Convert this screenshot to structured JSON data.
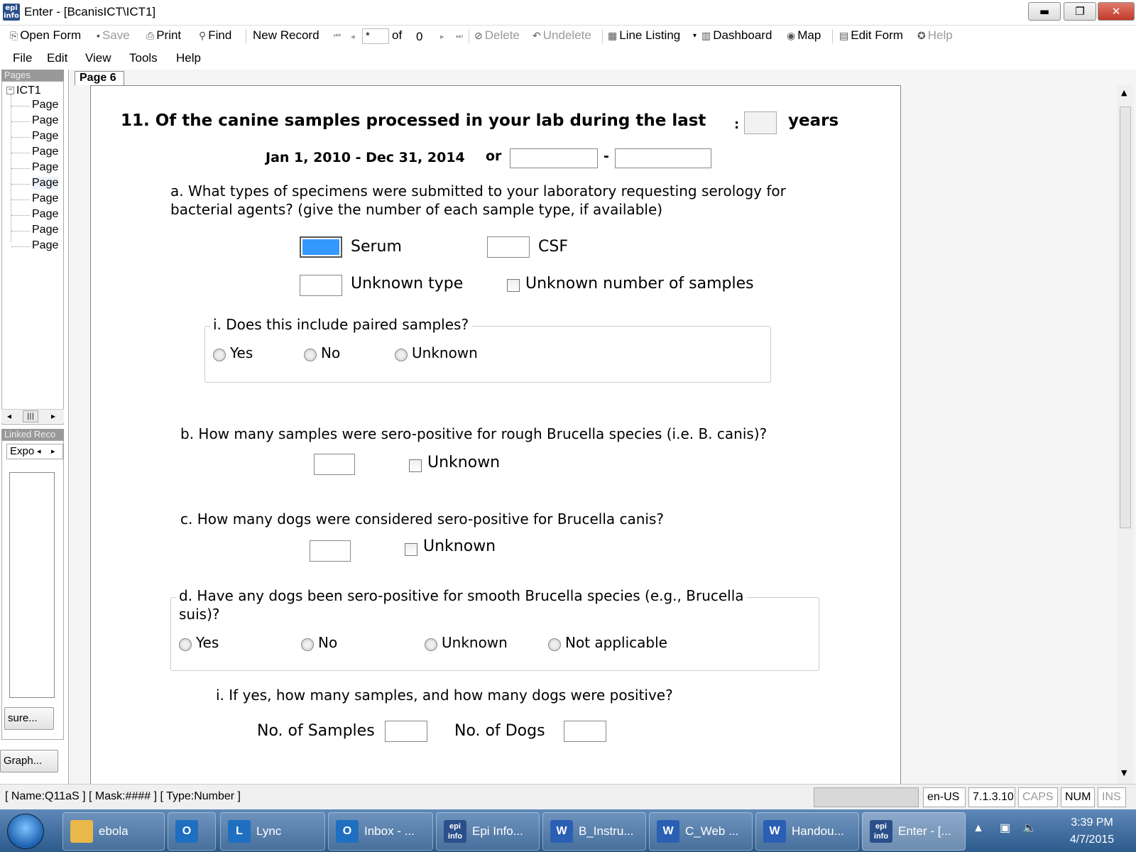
{
  "window": {
    "title": "Enter - [BcanisICT\\ICT1]",
    "logo": "epi info",
    "controls": {
      "minimize": "▬",
      "maximize": "❐",
      "close": "✕"
    }
  },
  "toolbar": {
    "open_form": "Open Form",
    "save": "Save",
    "print": "Print",
    "find": "Find",
    "new_record": "New Record",
    "record_current": "*",
    "record_of": "of",
    "record_total": "0",
    "delete": "Delete",
    "undelete": "Undelete",
    "line_listing": "Line Listing",
    "dashboard": "Dashboard",
    "map": "Map",
    "edit_form": "Edit Form",
    "help": "Help"
  },
  "menu": [
    "File",
    "Edit",
    "View",
    "Tools",
    "Help"
  ],
  "pages_panel": {
    "header": "Pages",
    "root": "ICT1",
    "items": [
      "Page",
      "Page",
      "Page",
      "Page",
      "Page",
      "Page",
      "Page",
      "Page",
      "Page",
      "Page"
    ]
  },
  "linked_panel": {
    "header": "Linked Reco",
    "tab": "Expo",
    "button1": "sure...",
    "button2": "Graph..."
  },
  "page_tab": "Page 6",
  "form": {
    "q11": "11. Of the canine samples processed in your lab during the last",
    "q11_colon": ":",
    "q11_years": "years",
    "date_range": "Jan 1, 2010 - Dec 31, 2014",
    "date_or": "or",
    "date_dash": "-",
    "qa": "a. What types of specimens were submitted to your laboratory requesting serology for",
    "qa_line2": "bacterial agents?  (give the number of each sample type, if available)",
    "serum": "Serum",
    "csf": "CSF",
    "unknown_type": "Unknown type",
    "unknown_number": "Unknown number of samples",
    "qai": "i. Does this include paired samples?",
    "qai_options": [
      "Yes",
      "No",
      "Unknown"
    ],
    "qb": "b. How many samples were sero-positive for rough Brucella species (i.e. B. canis)?",
    "qb_unknown": "Unknown",
    "qc": "c. How many dogs were considered sero-positive for Brucella canis?",
    "qc_unknown": "Unknown",
    "qd": "d. Have any dogs been sero-positive for smooth Brucella species (e.g., Brucella",
    "qd_line2": "suis)?",
    "qd_options": [
      "Yes",
      "No",
      "Unknown",
      "Not applicable"
    ],
    "qdi": "i. If yes, how many samples, and how many dogs were positive?",
    "no_samples": "No. of Samples",
    "no_dogs": "No. of Dogs"
  },
  "statusbar": {
    "field_info": "[ Name:Q11aS ] [ Mask:#### ] [ Type:Number ]",
    "locale": "en-US",
    "version": "7.1.3.10",
    "caps": "CAPS",
    "num": "NUM",
    "ins": "INS"
  },
  "taskbar": {
    "items": [
      {
        "label": "ebola",
        "icon": "folder-icon",
        "color": "#e8b84a"
      },
      {
        "label": "",
        "icon": "outlook-icon",
        "color": "#1f6fc1"
      },
      {
        "label": "Lync",
        "icon": "lync-icon",
        "color": "#1f6fc1"
      },
      {
        "label": "Inbox - ...",
        "icon": "outlook-icon",
        "color": "#1f6fc1"
      },
      {
        "label": "Epi Info...",
        "icon": "epi-info-icon",
        "color": "#2a4f8a"
      },
      {
        "label": "B_Instru...",
        "icon": "word-icon",
        "color": "#2b5fb4"
      },
      {
        "label": "C_Web ...",
        "icon": "word-icon",
        "color": "#2b5fb4"
      },
      {
        "label": "Handou...",
        "icon": "word-icon",
        "color": "#2b5fb4"
      },
      {
        "label": "Enter - [...",
        "icon": "epi-info-icon",
        "color": "#2a4f8a"
      }
    ],
    "time": "3:39 PM",
    "date": "4/7/2015"
  }
}
